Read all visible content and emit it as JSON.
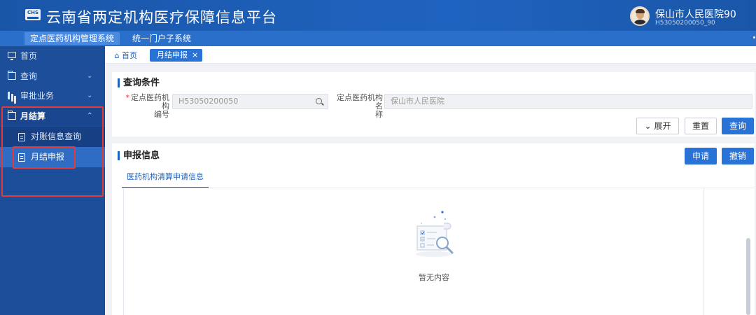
{
  "header": {
    "logo_text": "CHS",
    "title": "云南省两定机构医疗保障信息平台",
    "user_name": "保山市人民医院90",
    "user_code": "H53050200050_90"
  },
  "system_tabs": [
    {
      "label": "定点医药机构管理系统",
      "active": true
    },
    {
      "label": "统一门户子系统",
      "active": false
    }
  ],
  "sidebar": {
    "items": [
      {
        "label": "首页",
        "icon": "monitor-icon"
      },
      {
        "label": "查询",
        "icon": "folder-icon",
        "chevron": "⌄"
      },
      {
        "label": "审批业务",
        "icon": "bar-chart-icon",
        "chevron": "⌄"
      },
      {
        "label": "月结算",
        "icon": "folder-icon",
        "chevron": "⌃",
        "open": true
      }
    ],
    "subitems": [
      {
        "label": "对账信息查询",
        "icon": "document-icon"
      },
      {
        "label": "月结申报",
        "icon": "document-icon",
        "active": true
      }
    ]
  },
  "tabbar": {
    "home_label": "首页",
    "active_tab_label": "月结申报",
    "close_symbol": "×"
  },
  "query_panel": {
    "title": "查询条件",
    "fields": [
      {
        "label_line1": "定点医药机构",
        "label_line2": "编号",
        "required": "*",
        "value": "H53050200050"
      },
      {
        "label_line1": "定点医药机构名",
        "label_line2": "称",
        "value": "保山市人民医院"
      }
    ],
    "buttons": {
      "expand": "展开",
      "expand_icon": "⌄",
      "reset": "重置",
      "query": "查询"
    }
  },
  "info_panel": {
    "title": "申报信息",
    "apply_button": "申请",
    "revoke_button": "撤销",
    "subtab_label": "医药机构清算申请信息",
    "empty_text": "暂无内容"
  },
  "colors": {
    "primary": "#2a73d6",
    "header_bg": "#1a56a8",
    "sidebar_bg": "#1c4e9a",
    "highlight_red": "#e33a3a"
  }
}
